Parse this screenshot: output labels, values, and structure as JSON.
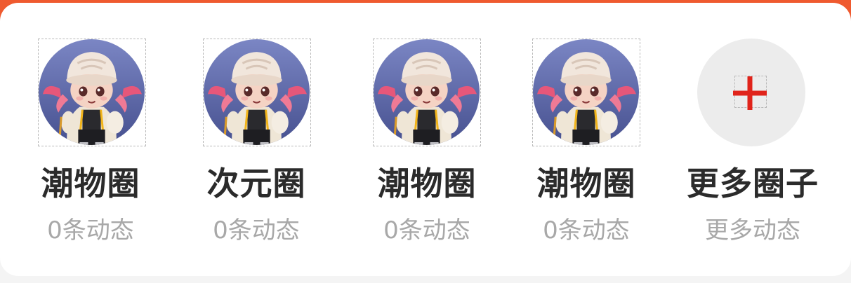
{
  "circles": [
    {
      "title": "潮物圈",
      "subtitle": "0条动态"
    },
    {
      "title": "次元圈",
      "subtitle": "0条动态"
    },
    {
      "title": "潮物圈",
      "subtitle": "0条动态"
    },
    {
      "title": "潮物圈",
      "subtitle": "0条动态"
    }
  ],
  "more": {
    "title": "更多圈子",
    "subtitle": "更多动态",
    "icon": "plus-icon"
  },
  "colors": {
    "header": "#ef5a2f",
    "plus": "#e0231a",
    "title": "#2b2b2b",
    "subtitle": "#a8a8a8"
  }
}
